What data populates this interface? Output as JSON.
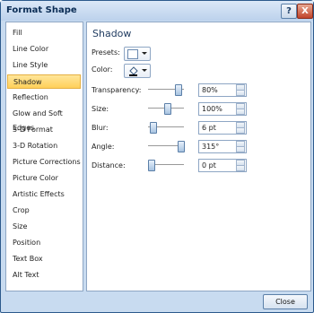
{
  "window": {
    "title": "Format Shape",
    "help_label": "?",
    "close_label": "X"
  },
  "nav": {
    "items": [
      "Fill",
      "Line Color",
      "Line Style",
      "Shadow",
      "Reflection",
      "Glow and Soft Edges",
      "3-D Format",
      "3-D Rotation",
      "Picture Corrections",
      "Picture Color",
      "Artistic Effects",
      "Crop",
      "Size",
      "Position",
      "Text Box",
      "Alt Text"
    ],
    "selected": "Shadow"
  },
  "panel": {
    "title": "Shadow",
    "presets_label": "Presets:",
    "color_label": "Color:",
    "rows": [
      {
        "label": "Transparency:",
        "value": "80%",
        "level": 0.8
      },
      {
        "label": "Size:",
        "value": "100%",
        "level": 0.5
      },
      {
        "label": "Blur:",
        "value": "6 pt",
        "level": 0.1
      },
      {
        "label": "Angle:",
        "value": "315°",
        "level": 0.88
      },
      {
        "label": "Distance:",
        "value": "0 pt",
        "level": 0.0
      }
    ]
  },
  "footer": {
    "close_label": "Close"
  }
}
